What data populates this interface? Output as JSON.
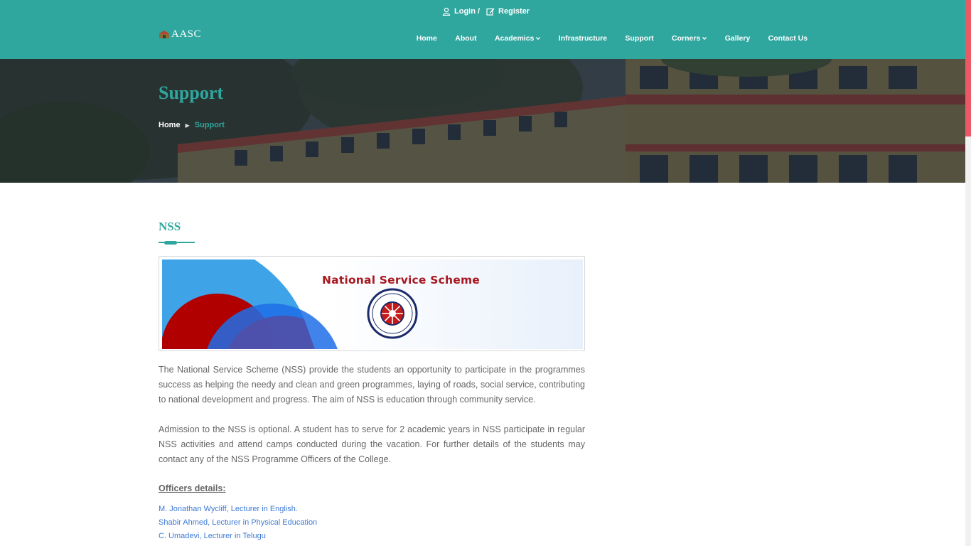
{
  "colors": {
    "accent": "#2fa79f",
    "header_bg": "#2fa79f",
    "link": "#3d7ad6",
    "scroll_thumb": "#ea5a66",
    "nss_red": "#a81820"
  },
  "topbar": {
    "login_label": "Login /",
    "register_label": "Register",
    "login_icon": "user-icon",
    "register_icon": "edit-icon"
  },
  "logo": {
    "text": "AASC"
  },
  "nav": {
    "items": [
      {
        "label": "Home"
      },
      {
        "label": "About"
      },
      {
        "label": "Academics",
        "dropdown": true
      },
      {
        "label": "Infrastructure"
      },
      {
        "label": "Support"
      },
      {
        "label": "Corners",
        "dropdown": true
      },
      {
        "label": "Gallery"
      },
      {
        "label": "Contact Us"
      }
    ]
  },
  "banner": {
    "title": "Support",
    "breadcrumb": {
      "home": "Home",
      "separator": "▶",
      "current": "Support"
    }
  },
  "section": {
    "title": "NSS",
    "image": {
      "heading": "National Service Scheme"
    },
    "paragraphs": [
      "The National Service Scheme (NSS) provide the students an opportunity to participate in the programmes success as helping the needy and clean and green programmes, laying of roads, social service, contributing to national development and progress. The aim of NSS is education through community service.",
      "Admission to the NSS is optional. A student has to serve for 2 academic years in NSS participate in regular NSS activities and attend camps conducted during the vacation. For further details of the students may contact any of the NSS Programme Officers of the College."
    ],
    "officers_label": "Officers details:",
    "officers": [
      "M. Jonathan Wycliff, Lecturer in English.",
      "Shabir Ahmed, Lecturer in Physical Education",
      "C. Umadevi, Lecturer in Telugu"
    ]
  }
}
